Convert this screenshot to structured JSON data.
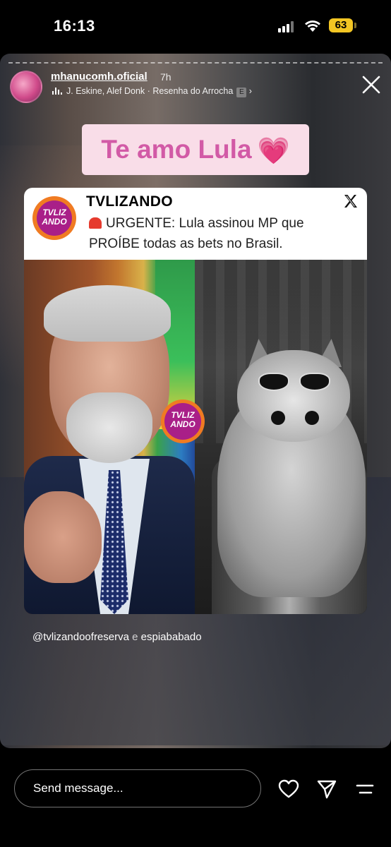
{
  "status_bar": {
    "time": "16:13",
    "battery": "63"
  },
  "story": {
    "username": "mhanucomh.oficial",
    "posted_ago": "7h",
    "music": {
      "artists": "J. Eskine, Alef Donk",
      "separator": "·",
      "track": "Resenha do Arrocha",
      "explicit_badge": "E",
      "chevron": "›"
    },
    "sticker_text": "Te amo Lula",
    "sticker_emoji": "💗",
    "post": {
      "account": "TVLIZANDO",
      "logo_text": "TVLIZ ANDO",
      "platform": "X",
      "text": "URGENTE: Lula assinou MP que PROÍBE todas as bets no Brasil."
    },
    "mentions": {
      "first": "@tvlizandoofreserva",
      "joiner": "e",
      "second": "espiababado"
    }
  },
  "bottom_bar": {
    "message_placeholder": "Send message..."
  },
  "colors": {
    "sticker_bg": "#f9dde8",
    "sticker_text": "#d25aa6",
    "logo_orange": "#f07b22",
    "logo_purple": "#a91f88",
    "battery": "#f3c623"
  }
}
